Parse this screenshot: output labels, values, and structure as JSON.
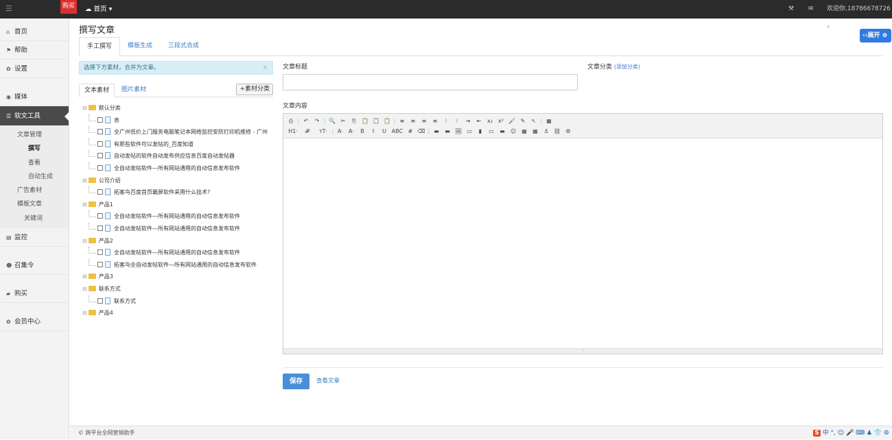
{
  "topbar": {
    "buy_badge": "购买",
    "home": "首页",
    "welcome": "欢迎你,18786678726"
  },
  "sidebar": {
    "items": [
      {
        "icon": "home-icon",
        "label": "首页"
      },
      {
        "icon": "flag-icon",
        "label": "帮助"
      },
      {
        "icon": "gear-icon",
        "label": "设置"
      },
      {
        "icon": "map-marker-icon",
        "label": "媒体"
      },
      {
        "icon": "list-icon",
        "label": "软文工具"
      },
      {
        "icon": "monitor-icon",
        "label": "监控"
      },
      {
        "icon": "group-icon",
        "label": "召集令"
      },
      {
        "icon": "briefcase-icon",
        "label": "购买"
      },
      {
        "icon": "gear-icon",
        "label": "会员中心"
      }
    ],
    "sub": [
      "文章管理",
      "撰写",
      "查看",
      "自动生成",
      "广告素材",
      "模板文章",
      "关键词"
    ]
  },
  "page": {
    "title": "撰写文章",
    "tabs": [
      "手工撰写",
      "模板生成",
      "三段式合成"
    ],
    "alert": "选择下方素材，合并为文章。",
    "alert_close": "×",
    "material_tabs": [
      "文本素材",
      "图片素材"
    ],
    "add_category": "+素材分类",
    "expand": "展开"
  },
  "tree": [
    {
      "folder": "默认分类",
      "items": [
        "息",
        "全广州低价上门服务电脑笔记本网络监控安防打印机维修 - 广州",
        "有那些软件可以发帖的_百度知道",
        "自动发帖的软件自动发布供应信息百度自动发帖器",
        "全自动发帖软件—所有网站通用的自动信息发布软件"
      ]
    },
    {
      "folder": "公司介绍",
      "items": [
        "拓客鸟百度首页霸屏软件采用什么技术?"
      ]
    },
    {
      "folder": "产品1",
      "items": [
        "全自动发帖软件—所有网站通用的自动信息发布软件",
        "全自动发帖软件—所有网站通用的自动信息发布软件"
      ]
    },
    {
      "folder": "产品2",
      "items": [
        "全自动发帖软件—所有网站通用的自动信息发布软件",
        "拓客鸟全自动发帖软件—所有网站通用的自动信息发布软件"
      ]
    },
    {
      "folder": "产品3",
      "items": []
    },
    {
      "folder": "联系方式",
      "items": [
        "联系方式"
      ]
    },
    {
      "folder": "产品4",
      "items": []
    }
  ],
  "form": {
    "title_label": "文章标题",
    "category_label": "文章分类",
    "add_category_link": "(添加分类)",
    "content_label": "文章内容",
    "save": "保存",
    "view_articles": "查看文章"
  },
  "toolbar": {
    "row1": [
      "⎙",
      "|",
      "↶",
      "↷",
      "|",
      "🔍",
      "✂",
      "⎘",
      "📋",
      "📋",
      "📋",
      "|",
      "≡",
      "≡",
      "≡",
      "≡",
      "⁝",
      "⁝",
      "⇥",
      "⇤",
      "x₂",
      "x²",
      "🖌",
      "✎",
      "↖",
      "|",
      "▦"
    ],
    "row2": [
      "H1·",
      "𝓕·",
      "тT·",
      "|",
      "A·",
      "A·",
      "B",
      "I",
      "U",
      "ABC",
      "#",
      "⌫",
      "|",
      "▬",
      "▬",
      "🖼",
      "▭",
      "▮",
      "▭",
      "▬",
      "☺",
      "▦",
      "▦",
      "⚓",
      "⛓",
      "⚙"
    ]
  },
  "footer": {
    "copyright": "© 跨平台全网营销助手",
    "ime": "中 °, ☺ 🎤 ⌨ ♟ 👕 ⚙"
  }
}
